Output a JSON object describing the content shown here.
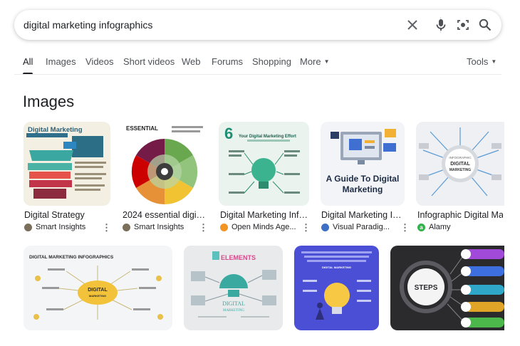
{
  "search": {
    "query": "digital marketing infographics"
  },
  "tabs": [
    {
      "label": "All",
      "active": true
    },
    {
      "label": "Images"
    },
    {
      "label": "Videos"
    },
    {
      "label": "Short videos"
    },
    {
      "label": "Web"
    },
    {
      "label": "Forums"
    },
    {
      "label": "Shopping"
    },
    {
      "label": "More"
    }
  ],
  "tools_label": "Tools",
  "section_title": "Images",
  "row1": [
    {
      "title": "Digital Strategy",
      "source": "Smart Insights",
      "thumb_title": "Digital Marketing",
      "favicon_color": "#7a6f5a"
    },
    {
      "title": "2024 essential digital...",
      "source": "Smart Insights",
      "thumb_title": "ESSENTIAL",
      "favicon_color": "#7a6f5a"
    },
    {
      "title": "Digital Marketing Infog...",
      "source": "Open Minds Age...",
      "thumb_title": "Your Digital Marketing Effort",
      "thumb_number": "6",
      "favicon_color": "#f29423"
    },
    {
      "title": "Digital Marketing Inf...",
      "source": "Visual Paradig...",
      "thumb_line1": "A Guide To Digital",
      "thumb_line2": "Marketing",
      "favicon_color": "#3d6fc4"
    },
    {
      "title": "Infographic Digital Marke",
      "source": "Alamy",
      "thumb_line1": "INFOGRAPHIC",
      "thumb_line2": "DIGITAL",
      "thumb_line3": "MARKETING",
      "favicon_color": "#2fb34a",
      "favicon_letter": "a"
    }
  ],
  "row2": [
    {
      "thumb_title": "DIGITAL MARKETING INFOGRAPHICS",
      "center_line1": "DIGITAL",
      "center_line2": "MARKETING"
    },
    {
      "thumb_title": "ELEMENTS",
      "thumb_line2": "DIGITAL",
      "thumb_line3": "MARKETING"
    },
    {
      "thumb_title": "DIGITAL MARKETING"
    },
    {
      "center_line1": "STEPS"
    }
  ],
  "colors": {
    "accent_blue": "#1a73e8",
    "text_primary": "#202124",
    "text_secondary": "#4d5156"
  }
}
